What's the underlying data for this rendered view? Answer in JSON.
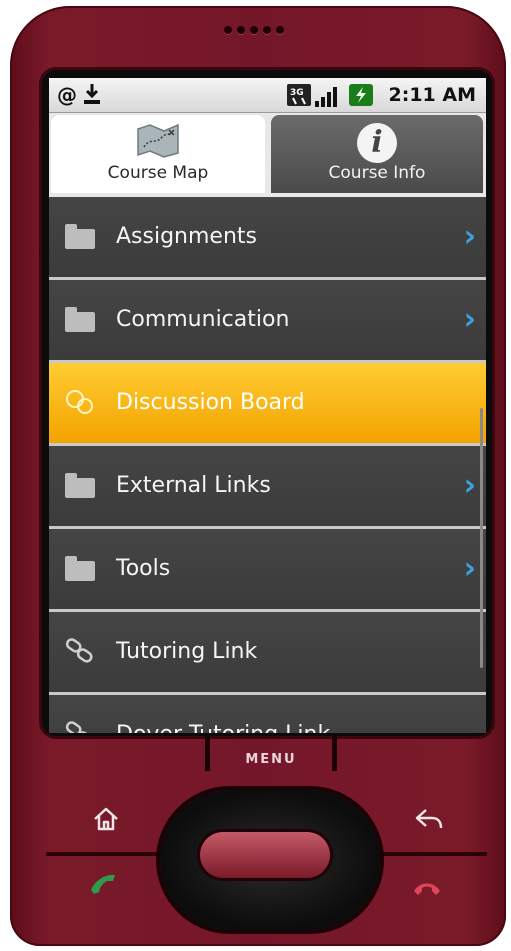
{
  "status_bar": {
    "time": "2:11 AM",
    "network": "3G",
    "icons": [
      "at-sign-icon",
      "download-icon",
      "network-3g-icon",
      "signal-icon",
      "battery-charging-icon"
    ]
  },
  "tabs": [
    {
      "label": "Course Map",
      "icon": "course-map-icon",
      "selected": true
    },
    {
      "label": "Course Info",
      "icon": "info-icon",
      "selected": false
    }
  ],
  "list": {
    "items": [
      {
        "label": "Assignments",
        "icon": "folder-icon",
        "has_chevron": true
      },
      {
        "label": "Communication",
        "icon": "folder-icon",
        "has_chevron": true
      },
      {
        "label": "Discussion Board",
        "icon": "discussion-icon",
        "has_chevron": false,
        "highlighted": true
      },
      {
        "label": "External Links",
        "icon": "folder-icon",
        "has_chevron": true
      },
      {
        "label": "Tools",
        "icon": "folder-icon",
        "has_chevron": true
      },
      {
        "label": "Tutoring Link",
        "icon": "link-icon",
        "has_chevron": false
      },
      {
        "label": "Dover Tutoring Link",
        "icon": "link-icon",
        "has_chevron": false
      }
    ]
  },
  "hardware": {
    "menu_label": "MENU"
  },
  "colors": {
    "phone_body": "#74172a",
    "highlight": "#f7b500",
    "chevron": "#3aa3e0",
    "call": "#2e9a4a",
    "end_call": "#e0465a"
  }
}
